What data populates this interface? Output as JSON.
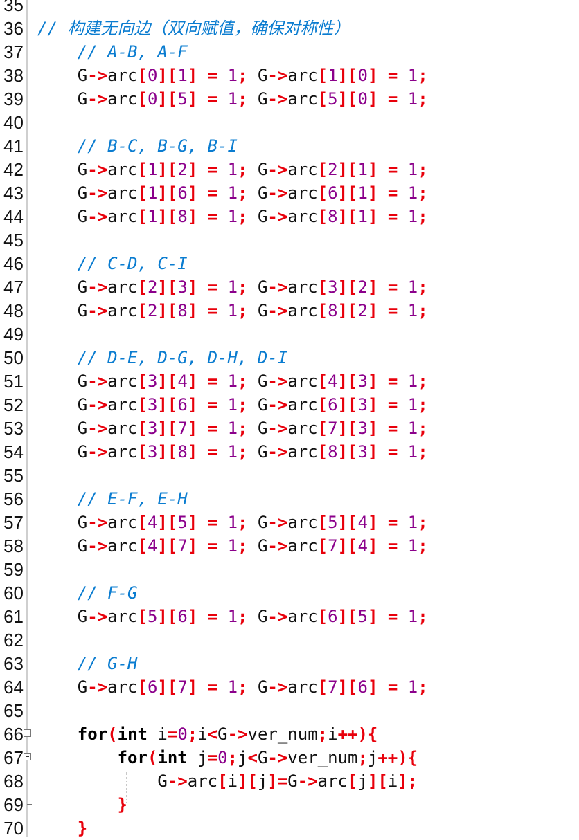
{
  "editor": {
    "first_line": 35,
    "lines": [
      "",
      "// 构建无向边（双向赋值，确保对称性）",
      "    // A-B, A-F",
      "    G->arc[0][1] = 1; G->arc[1][0] = 1;",
      "    G->arc[0][5] = 1; G->arc[5][0] = 1;",
      "",
      "    // B-C, B-G, B-I",
      "    G->arc[1][2] = 1; G->arc[2][1] = 1;",
      "    G->arc[1][6] = 1; G->arc[6][1] = 1;",
      "    G->arc[1][8] = 1; G->arc[8][1] = 1;",
      "",
      "    // C-D, C-I",
      "    G->arc[2][3] = 1; G->arc[3][2] = 1;",
      "    G->arc[2][8] = 1; G->arc[8][2] = 1;",
      "",
      "    // D-E, D-G, D-H, D-I",
      "    G->arc[3][4] = 1; G->arc[4][3] = 1;",
      "    G->arc[3][6] = 1; G->arc[6][3] = 1;",
      "    G->arc[3][7] = 1; G->arc[7][3] = 1;",
      "    G->arc[3][8] = 1; G->arc[8][3] = 1;",
      "",
      "    // E-F, E-H",
      "    G->arc[4][5] = 1; G->arc[5][4] = 1;",
      "    G->arc[4][7] = 1; G->arc[7][4] = 1;",
      "",
      "    // F-G",
      "    G->arc[5][6] = 1; G->arc[6][5] = 1;",
      "",
      "    // G-H",
      "    G->arc[6][7] = 1; G->arc[7][6] = 1;",
      "",
      "    for(int i=0;i<G->ver_num;i++){",
      "        for(int j=0;j<G->ver_num;j++){",
      "            G->arc[i][j]=G->arc[j][i];",
      "        }",
      "    }"
    ],
    "fold_lines": [
      66,
      67
    ],
    "colors": {
      "comment": "#0a7cd0",
      "operator": "#e8000b",
      "number": "#8b008b",
      "keyword": "#000080",
      "text": "#111111"
    }
  }
}
